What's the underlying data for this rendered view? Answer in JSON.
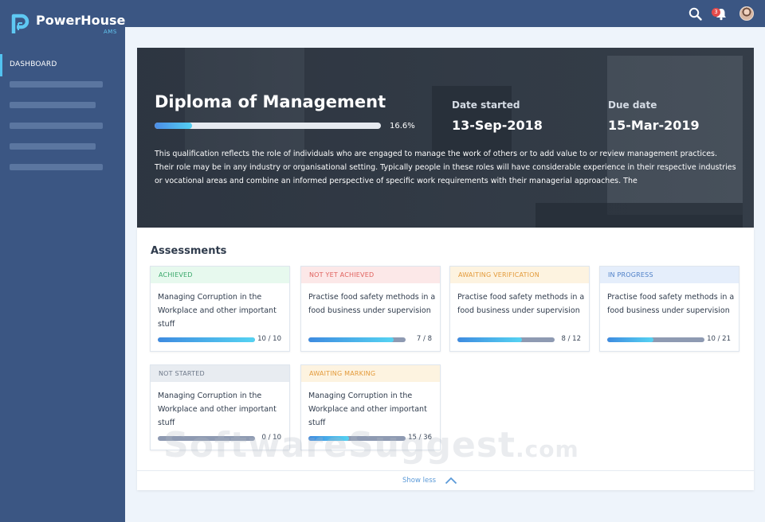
{
  "app": {
    "brand_name": "PowerHouse",
    "brand_sub": "AMS",
    "notification_count": "3"
  },
  "sidebar": {
    "active_item": "DASHBOARD"
  },
  "hero": {
    "title": "Diploma of Management",
    "progress_percent": 16.6,
    "progress_label": "16.6%",
    "date_started_label": "Date started",
    "date_started": "13-Sep-2018",
    "due_date_label": "Due date",
    "due_date": "15-Mar-2019",
    "description": "This qualification reflects the role of individuals who are engaged to manage the work of others or to add value to or review management practices. Their role may be in any industry or organisational setting. Typically people in these roles will have considerable experience in their respective industries or vocational areas and combine an informed perspective of specific work requirements with their managerial approaches. The"
  },
  "assessments": {
    "title": "Assessments",
    "cards": [
      {
        "status": "ACHIEVED",
        "title": "Managing Corruption in the Workplace and other important stuff",
        "count": "10 / 10",
        "progress": 1.0
      },
      {
        "status": "NOT YET ACHIEVED",
        "title": "Practise food safety methods in a food business under supervision",
        "count": "7 / 8",
        "progress": 0.875
      },
      {
        "status": "AWAITING VERIFICATION",
        "title": "Practise food safety methods in a food business under supervision",
        "count": "8 / 12",
        "progress": 0.6667
      },
      {
        "status": "IN PROGRESS",
        "title": "Practise food safety methods in a food business under supervision",
        "count": "10 / 21",
        "progress": 0.476
      },
      {
        "status": "NOT STARTED",
        "title": "Managing Corruption in the Workplace and other important stuff",
        "count": "0 / 10",
        "progress": 0.0
      },
      {
        "status": "AWAITING MARKING",
        "title": "Managing Corruption in the Workplace and other important stuff",
        "count": "15 / 36",
        "progress": 0.4167
      }
    ],
    "show_less": "Show less"
  },
  "watermark": {
    "text": "SoftwareSuggest",
    "suffix": ".com"
  },
  "icons": {
    "search": "search-icon",
    "bell": "bell-icon",
    "chevron": "chevron-up-icon"
  },
  "colors": {
    "nav_bg": "#3b5683",
    "accent": "#52c2f0"
  }
}
